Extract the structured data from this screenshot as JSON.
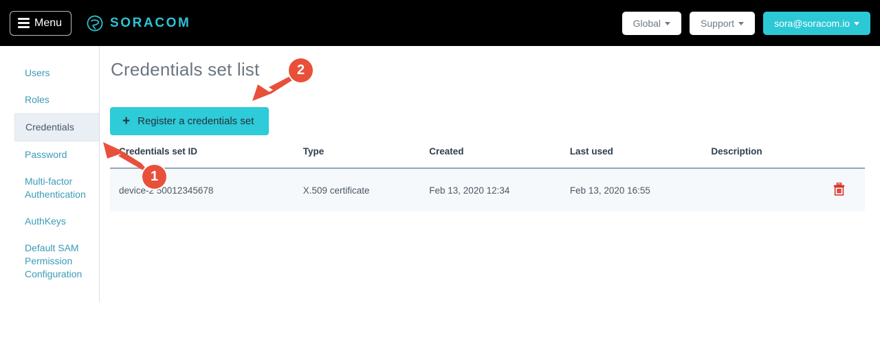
{
  "topnav": {
    "menu_label": "Menu",
    "menu_icon": "hamburger-icon",
    "brand_name": "SORACOM",
    "brand_logo_icon": "soracom-logo-icon",
    "region_label": "Global",
    "support_label": "Support",
    "account_label": "sora@soracom.io",
    "caret_icon": "chevron-down-icon"
  },
  "sidebar": {
    "items": [
      {
        "label": "Users",
        "active": false
      },
      {
        "label": "Roles",
        "active": false
      },
      {
        "label": "Credentials",
        "active": true
      },
      {
        "label": "Password",
        "active": false
      },
      {
        "label": "Multi-factor Authentication",
        "active": false
      },
      {
        "label": "AuthKeys",
        "active": false
      },
      {
        "label": "Default SAM Permission Configuration",
        "active": false
      }
    ]
  },
  "main": {
    "page_title": "Credentials set list",
    "register_button_label": "Register a credentials set",
    "register_button_icon": "plus-icon"
  },
  "table": {
    "headers": [
      "Credentials set ID",
      "Type",
      "Created",
      "Last used",
      "Description",
      ""
    ],
    "rows": [
      {
        "id": "device-2  50012345678",
        "type": "X.509 certificate",
        "created": "Feb 13, 2020 12:34",
        "last_used": "Feb 13, 2020 16:55",
        "description": "",
        "delete_icon": "trash-icon"
      }
    ]
  },
  "annotations": [
    {
      "number": "1",
      "target": "sidebar-item-credentials"
    },
    {
      "number": "2",
      "target": "register-a-credentials-set-button"
    }
  ],
  "colors": {
    "brand_teal": "#2bc4d4",
    "button_teal": "#2ecbd9",
    "topnav_black": "#000000",
    "annotation_red": "#e8503a",
    "link_blue": "#3a9bb5",
    "trash_red": "#d9362b"
  }
}
